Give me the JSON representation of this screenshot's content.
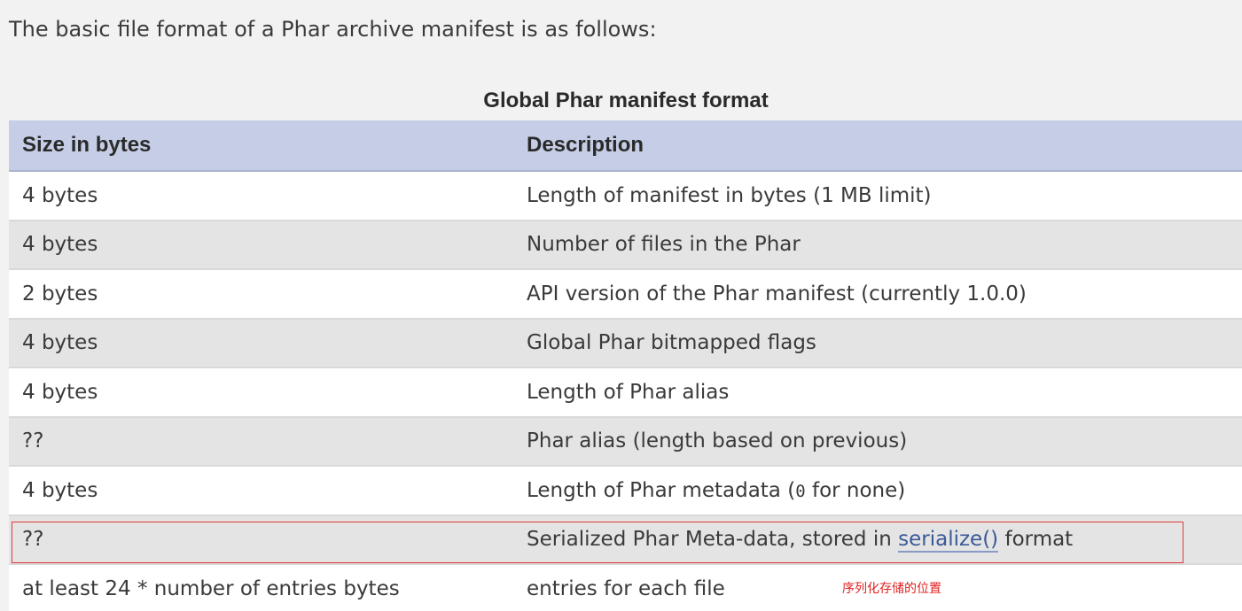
{
  "intro_text": "The basic file format of a Phar archive manifest is as follows:",
  "table": {
    "caption": "Global Phar manifest format",
    "headers": {
      "size": "Size in bytes",
      "description": "Description"
    },
    "rows": [
      {
        "size": "4 bytes",
        "description": "Length of manifest in bytes (1 MB limit)"
      },
      {
        "size": "4 bytes",
        "description": "Number of files in the Phar"
      },
      {
        "size": "2 bytes",
        "description": "API version of the Phar manifest (currently 1.0.0)"
      },
      {
        "size": "4 bytes",
        "description": "Global Phar bitmapped flags"
      },
      {
        "size": "4 bytes",
        "description": "Length of Phar alias"
      },
      {
        "size": "??",
        "description": "Phar alias (length based on previous)"
      },
      {
        "size": "4 bytes",
        "description_before": "Length of Phar metadata (",
        "description_code": "0",
        "description_after": " for none)"
      },
      {
        "size": "??",
        "description_before": "Serialized Phar Meta-data, stored in ",
        "description_link": "serialize()",
        "description_after": " format"
      },
      {
        "size": "at least 24 * number of entries bytes",
        "description": "entries for each file"
      }
    ]
  },
  "annotation": {
    "text": "序列化存储的位置",
    "color": "#e02020"
  },
  "colors": {
    "header_bg": "#c5cee6",
    "row_alt_bg": "#e4e4e4",
    "highlight_border": "#e03a3a",
    "link": "#3b5998"
  }
}
